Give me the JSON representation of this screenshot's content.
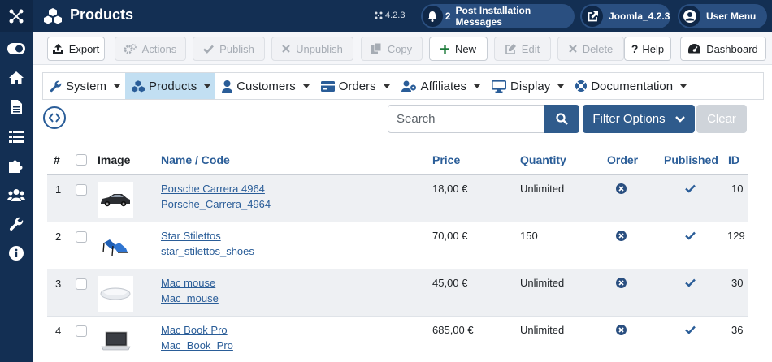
{
  "header": {
    "title": "Products",
    "version": "4.2.3",
    "notifications_count": "2",
    "notifications_label": "Post Installation Messages",
    "site_label": "Joomla_4.2.3",
    "user_menu_label": "User Menu"
  },
  "toolbar": {
    "export": "Export",
    "actions": "Actions",
    "publish": "Publish",
    "unpublish": "Unpublish",
    "copy": "Copy",
    "new": "New",
    "edit": "Edit",
    "delete": "Delete",
    "help": "Help",
    "dashboard": "Dashboard"
  },
  "menu": {
    "items": [
      {
        "label": "System",
        "icon": "wrench-icon",
        "active": false
      },
      {
        "label": "Products",
        "icon": "cubes-icon",
        "active": true
      },
      {
        "label": "Customers",
        "icon": "user-icon",
        "active": false
      },
      {
        "label": "Orders",
        "icon": "credit-card-icon",
        "active": false
      },
      {
        "label": "Affiliates",
        "icon": "users-icon",
        "active": false
      },
      {
        "label": "Display",
        "icon": "desktop-icon",
        "active": false
      },
      {
        "label": "Documentation",
        "icon": "lifebuoy-icon",
        "active": false
      }
    ]
  },
  "search": {
    "placeholder": "Search",
    "filter_label": "Filter Options",
    "clear_label": "Clear"
  },
  "table": {
    "headers": {
      "num": "#",
      "image": "Image",
      "name": "Name / Code",
      "price": "Price",
      "quantity": "Quantity",
      "order": "Order",
      "published": "Published",
      "id": "ID"
    },
    "rows": [
      {
        "num": "1",
        "name": "Porsche Carrera 4964",
        "code": "Porsche_Carrera_4964",
        "price": "18,00 €",
        "quantity": "Unlimited",
        "id": "10",
        "image": "car"
      },
      {
        "num": "2",
        "name": "Star Stilettos",
        "code": "star_stilettos_shoes",
        "price": "70,00 €",
        "quantity": "150",
        "id": "129",
        "image": "shoes"
      },
      {
        "num": "3",
        "name": "Mac mouse",
        "code": "Mac_mouse",
        "price": "45,00 €",
        "quantity": "Unlimited",
        "id": "30",
        "image": "mouse"
      },
      {
        "num": "4",
        "name": "Mac Book Pro",
        "code": "Mac_Book_Pro",
        "price": "685,00 €",
        "quantity": "Unlimited",
        "id": "36",
        "image": "laptop"
      }
    ]
  },
  "colors": {
    "sidebar": "#132f53",
    "accent": "#2f5b8c",
    "link": "#2a5d98",
    "active_menu": "#c2dff2"
  }
}
